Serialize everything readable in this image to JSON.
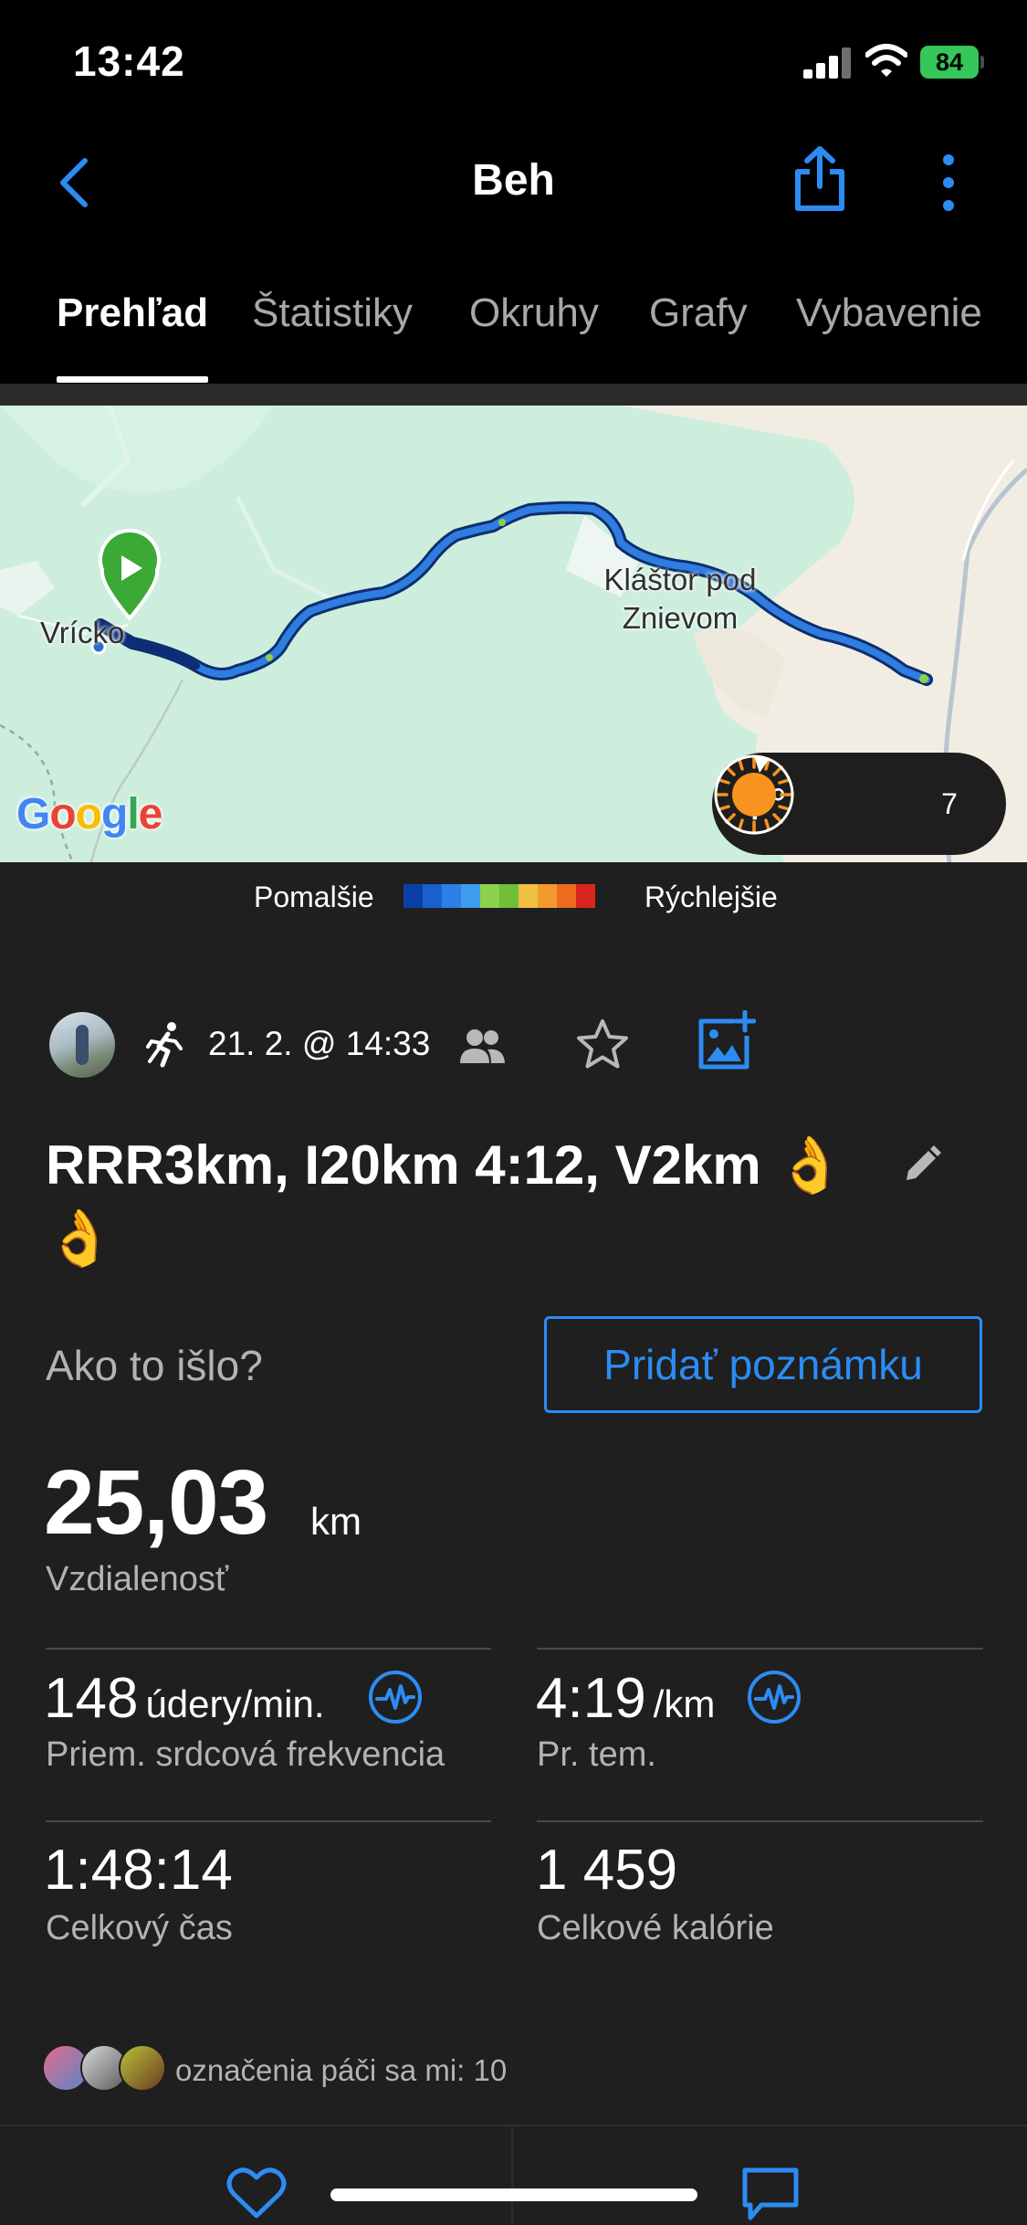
{
  "status_bar": {
    "time": "13:42",
    "battery": "84",
    "icons": [
      "cellular-signal-icon",
      "wifi-icon",
      "battery-icon"
    ]
  },
  "nav": {
    "title": "Beh",
    "icons": [
      "chevron-left-icon",
      "share-icon",
      "more-vertical-icon"
    ]
  },
  "tabs": [
    {
      "label": "Prehľad",
      "active": true
    },
    {
      "label": "Štatistiky",
      "active": false
    },
    {
      "label": "Okruhy",
      "active": false
    },
    {
      "label": "Grafy",
      "active": false
    },
    {
      "label": "Vybavenie",
      "active": false
    }
  ],
  "map": {
    "labels": {
      "start": "Vrícko",
      "place_line1": "Kláštor pod",
      "place_line2": "Znievom"
    },
    "attribution": "Google",
    "weather": {
      "temperature": "7°",
      "wind_speed": "7"
    }
  },
  "pace_legend": {
    "slower": "Pomalšie",
    "faster": "Rýchlejšie",
    "colors": [
      "#0a3fa6",
      "#1a5fd0",
      "#2c7fe6",
      "#3e9cf0",
      "#8bd14a",
      "#6fbf3a",
      "#f0c040",
      "#f29a2e",
      "#ee6a1f",
      "#d8261c"
    ]
  },
  "activity": {
    "date": "21. 2. @ 14:33",
    "title": "RRR3km, I20km 4:12, V2km 👌👌",
    "feel_question": "Ako to išlo?",
    "add_note": "Pridať poznámku"
  },
  "stats": {
    "distance": {
      "value": "25,03",
      "unit": "km",
      "label": "Vzdialenosť"
    },
    "heart_rate": {
      "value": "148",
      "unit": "údery/min.",
      "label": "Priem. srdcová frekvencia"
    },
    "pace": {
      "value": "4:19",
      "unit": "/km",
      "label": "Pr. tem."
    },
    "total_time": {
      "value": "1:48:14",
      "label": "Celkový čas"
    },
    "calories": {
      "value": "1 459",
      "label": "Celkové kalórie"
    }
  },
  "likes": {
    "text": "označenia páči sa mi: 10"
  },
  "colors": {
    "accent": "#2c8cf3",
    "background": "#1f1f1f",
    "chrome": "#000000",
    "battery": "#34c759",
    "start_marker": "#3aa935"
  }
}
